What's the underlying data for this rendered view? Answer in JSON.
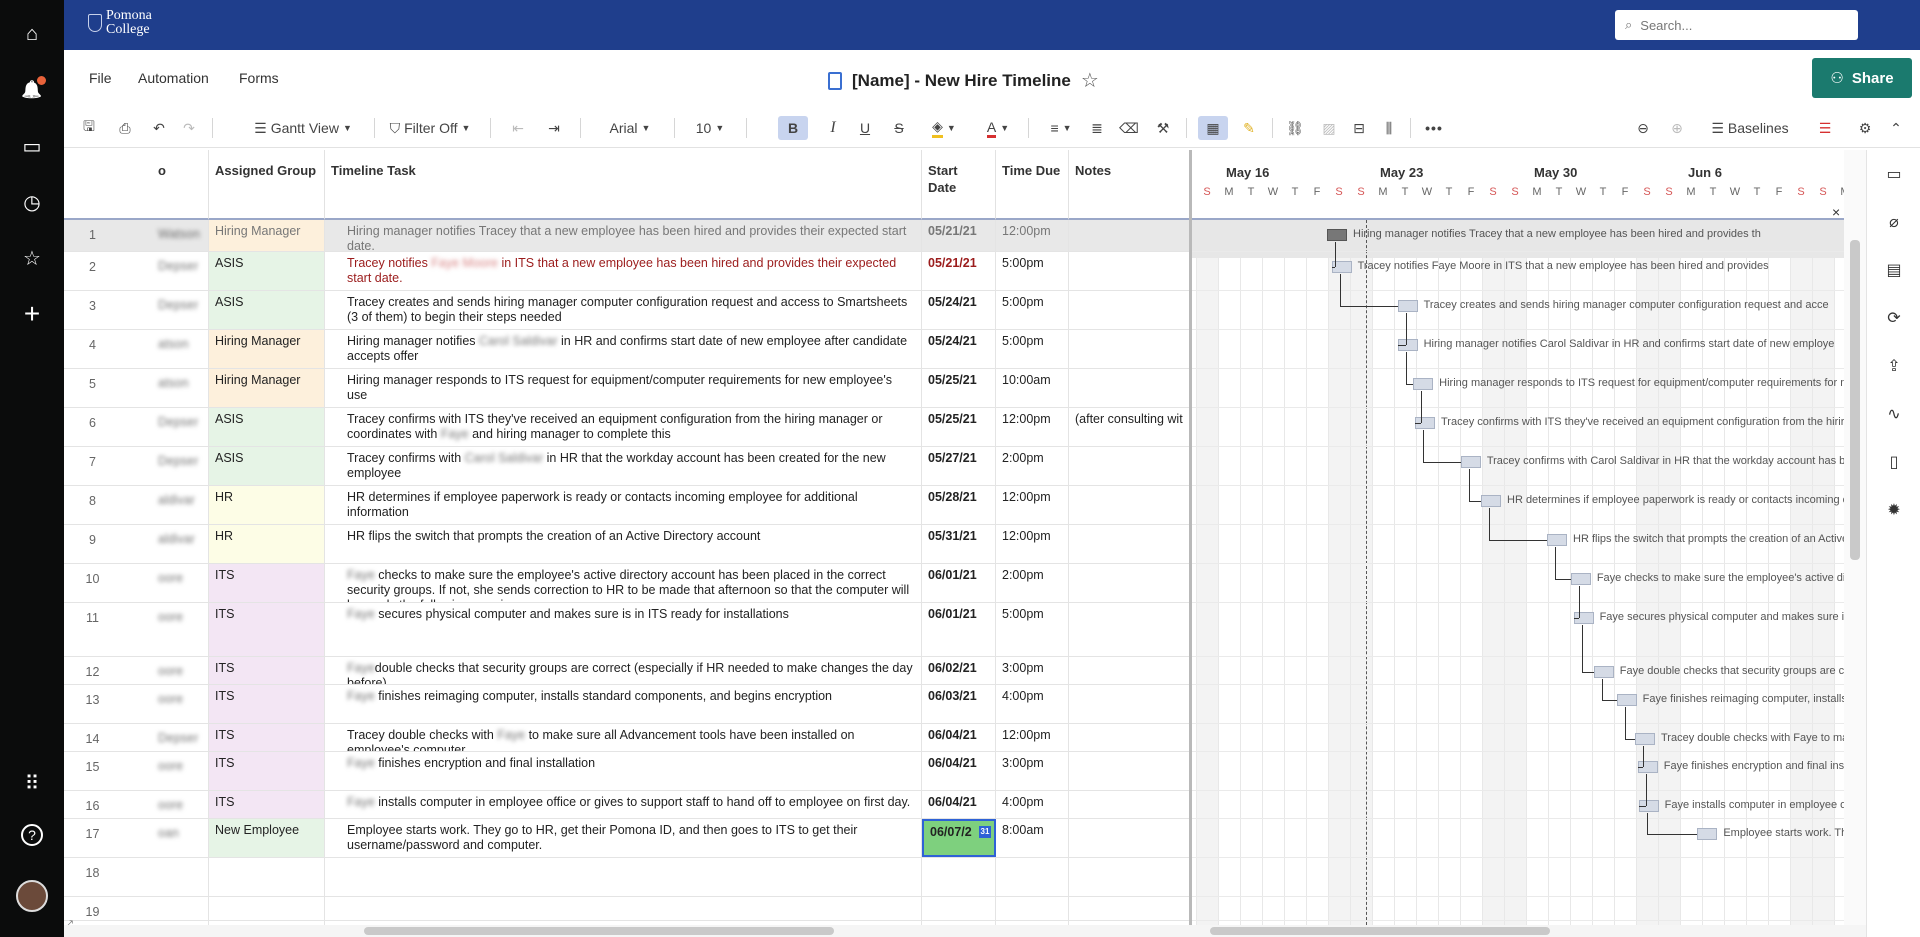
{
  "app": {
    "logo_text": "Pomona College",
    "search_placeholder": "Search..."
  },
  "leftrail": {
    "home": "⌂",
    "notifications": "🔔",
    "browse": "▭",
    "recents": "◷",
    "favorites": "☆",
    "create": "+",
    "apps": "⠿",
    "help": "?"
  },
  "menubar": {
    "file": "File",
    "automation": "Automation",
    "forms": "Forms",
    "title": "[Name] - New Hire Timeline",
    "share": "Share"
  },
  "toolbar": {
    "gantt_view": "Gantt View",
    "filter": "Filter Off",
    "font": "Arial",
    "font_size": "10",
    "baselines": "Baselines",
    "bold": "B",
    "italic": "I",
    "underline": "U",
    "strike": "S"
  },
  "columns": {
    "c0": "o",
    "assigned_group": "Assigned Group",
    "timeline_task": "Timeline Task",
    "start_date": "Start Date",
    "time_due": "Time Due",
    "notes": "Notes"
  },
  "rows": [
    {
      "n": "1",
      "who": "Watson",
      "group": "Hiring Manager",
      "task": "Hiring manager notifies Tracey that a new employee has been hired and provides their expected start date.",
      "date": "05/21/21",
      "time": "12:00pm",
      "notes": ""
    },
    {
      "n": "2",
      "who": "Depser",
      "group": "ASIS",
      "task_a": "Tracey notifies ",
      "task_blur": "Faye Moore",
      "task_b": " in ITS that a new employee has been hired and provides their expected start date.",
      "date": "05/21/21",
      "time": "5:00pm",
      "notes": ""
    },
    {
      "n": "3",
      "who": "Depser",
      "group": "ASIS",
      "task": "Tracey creates and sends hiring manager computer configuration request and access to Smartsheets (3 of them) to begin their steps needed",
      "date": "05/24/21",
      "time": "5:00pm",
      "notes": ""
    },
    {
      "n": "4",
      "who": "atson",
      "group": "Hiring Manager",
      "task_a": "Hiring manager notifies ",
      "task_blur": "Carol Saldivar",
      "task_b": " in HR and confirms start date of new employee after candidate accepts offer",
      "date": "05/24/21",
      "time": "5:00pm",
      "notes": ""
    },
    {
      "n": "5",
      "who": "atson",
      "group": "Hiring Manager",
      "task": "Hiring manager responds to ITS request for equipment/computer requirements for new employee's use",
      "date": "05/25/21",
      "time": "10:00am",
      "notes": ""
    },
    {
      "n": "6",
      "who": "Depser",
      "group": "ASIS",
      "task_a": "Tracey confirms with ITS they've received an equipment configuration from the hiring manager or coordinates with ",
      "task_blur": "Faye",
      "task_b": " and hiring manager to complete this",
      "date": "05/25/21",
      "time": "12:00pm",
      "notes": "(after consulting wit"
    },
    {
      "n": "7",
      "who": "Depser",
      "group": "ASIS",
      "task_a": "Tracey confirms with ",
      "task_blur": "Carol Saldivar",
      "task_b": " in HR that the workday account has been created for the new employee",
      "date": "05/27/21",
      "time": "2:00pm",
      "notes": ""
    },
    {
      "n": "8",
      "who": "aldivar",
      "group": "HR",
      "task": "HR determines if employee paperwork is ready or contacts incoming employee for additional information",
      "date": "05/28/21",
      "time": "12:00pm",
      "notes": ""
    },
    {
      "n": "9",
      "who": "aldivar",
      "group": "HR",
      "task": "HR flips the switch that prompts the creation of an Active Directory account",
      "date": "05/31/21",
      "time": "12:00pm",
      "notes": ""
    },
    {
      "n": "10",
      "who": "oore",
      "group": "ITS",
      "task_a": "",
      "task_blur": "Faye",
      "task_b": " checks to make sure the employee's active directory account has been placed in the correct security groups. If not, she sends correction to HR to be made that afternoon so that the computer will be ready the following morning.",
      "date": "06/01/21",
      "time": "2:00pm",
      "notes": ""
    },
    {
      "n": "11",
      "who": "oore",
      "group": "ITS",
      "task_a": "",
      "task_blur": "Faye",
      "task_b": " secures physical computer and makes sure is in ITS ready for installations",
      "date": "06/01/21",
      "time": "5:00pm",
      "notes": ""
    },
    {
      "n": "12",
      "who": "oore",
      "group": "ITS",
      "task_a": "",
      "task_blur": "Faye",
      "task_b": "double checks that security groups are correct (especially if HR needed to make changes the day before).",
      "date": "06/02/21",
      "time": "3:00pm",
      "notes": ""
    },
    {
      "n": "13",
      "who": "oore",
      "group": "ITS",
      "task_a": "",
      "task_blur": "Faye",
      "task_b": " finishes reimaging computer, installs standard components, and begins encryption",
      "date": "06/03/21",
      "time": "4:00pm",
      "notes": ""
    },
    {
      "n": "14",
      "who": "Depser",
      "group": "ITS",
      "task_a": "Tracey double checks with ",
      "task_blur": "Faye",
      "task_b": " to make sure all Advancement tools have been installed on employee's computer",
      "date": "06/04/21",
      "time": "12:00pm",
      "notes": ""
    },
    {
      "n": "15",
      "who": "oore",
      "group": "ITS",
      "task_a": "",
      "task_blur": "Faye",
      "task_b": " finishes encryption and final installation",
      "date": "06/04/21",
      "time": "3:00pm",
      "notes": ""
    },
    {
      "n": "16",
      "who": "oore",
      "group": "ITS",
      "task_a": "",
      "task_blur": "Faye",
      "task_b": " installs computer in employee office or gives to support staff to hand off to employee on first day.",
      "date": "06/04/21",
      "time": "4:00pm",
      "notes": ""
    },
    {
      "n": "17",
      "who": "oan",
      "group": "New Employee",
      "task": "Employee starts work. They go to HR, get their Pomona ID, and then goes to ITS to get their username/password and computer.",
      "date": "06/07/2",
      "time": "8:00am",
      "notes": ""
    },
    {
      "n": "18"
    },
    {
      "n": "19"
    },
    {
      "n": "20"
    }
  ],
  "gantt": {
    "weeks": [
      "May 16",
      "May 23",
      "May 30",
      "Jun 6"
    ],
    "days": [
      "S",
      "M",
      "T",
      "W",
      "T",
      "F",
      "S",
      "S",
      "M",
      "T",
      "W",
      "T",
      "F",
      "S",
      "S",
      "M",
      "T",
      "W",
      "T",
      "F",
      "S",
      "S",
      "M",
      "T",
      "W",
      "T",
      "F",
      "S",
      "S",
      "M",
      "T"
    ],
    "labels": [
      "Hiring manager notifies Tracey that a new employee has been hired and provides th",
      "Tracey notifies Faye Moore in ITS that a new employee has been hired and provides",
      "Tracey creates and sends hiring manager computer configuration request and acce",
      "Hiring manager notifies Carol Saldivar in HR and confirms start date of new employe",
      "Hiring manager responds to ITS request for equipment/computer requirements for n",
      "Tracey confirms with ITS they've received an equipment configuration from the hirir",
      "Tracey confirms with Carol Saldivar in HR that the workday account has bee",
      "HR determines if employee paperwork is ready or contacts incoming em",
      "HR flips the switch that prompts the creation of an Active D",
      "Faye checks to make sure the employee's active direct",
      "Faye secures physical computer and makes sure is in I",
      "Faye double checks that security groups are corre",
      "Faye finishes reimaging computer, installs sta",
      "Tracey double checks with Faye to make",
      "Faye finishes encryption and final installa",
      "Faye installs computer in employee office",
      "Employee starts work. They"
    ],
    "close": "×"
  },
  "colors": {
    "topbar": "#1f3e8c",
    "share": "#1b7a6e",
    "asis_group": "#e6f4e6",
    "hiring_group": "#fdf0dc",
    "hr_group": "#fdfde6",
    "its_group": "#f3e6f4",
    "new_group": "#e6f4e6",
    "selected_date": "#7ed07e"
  }
}
